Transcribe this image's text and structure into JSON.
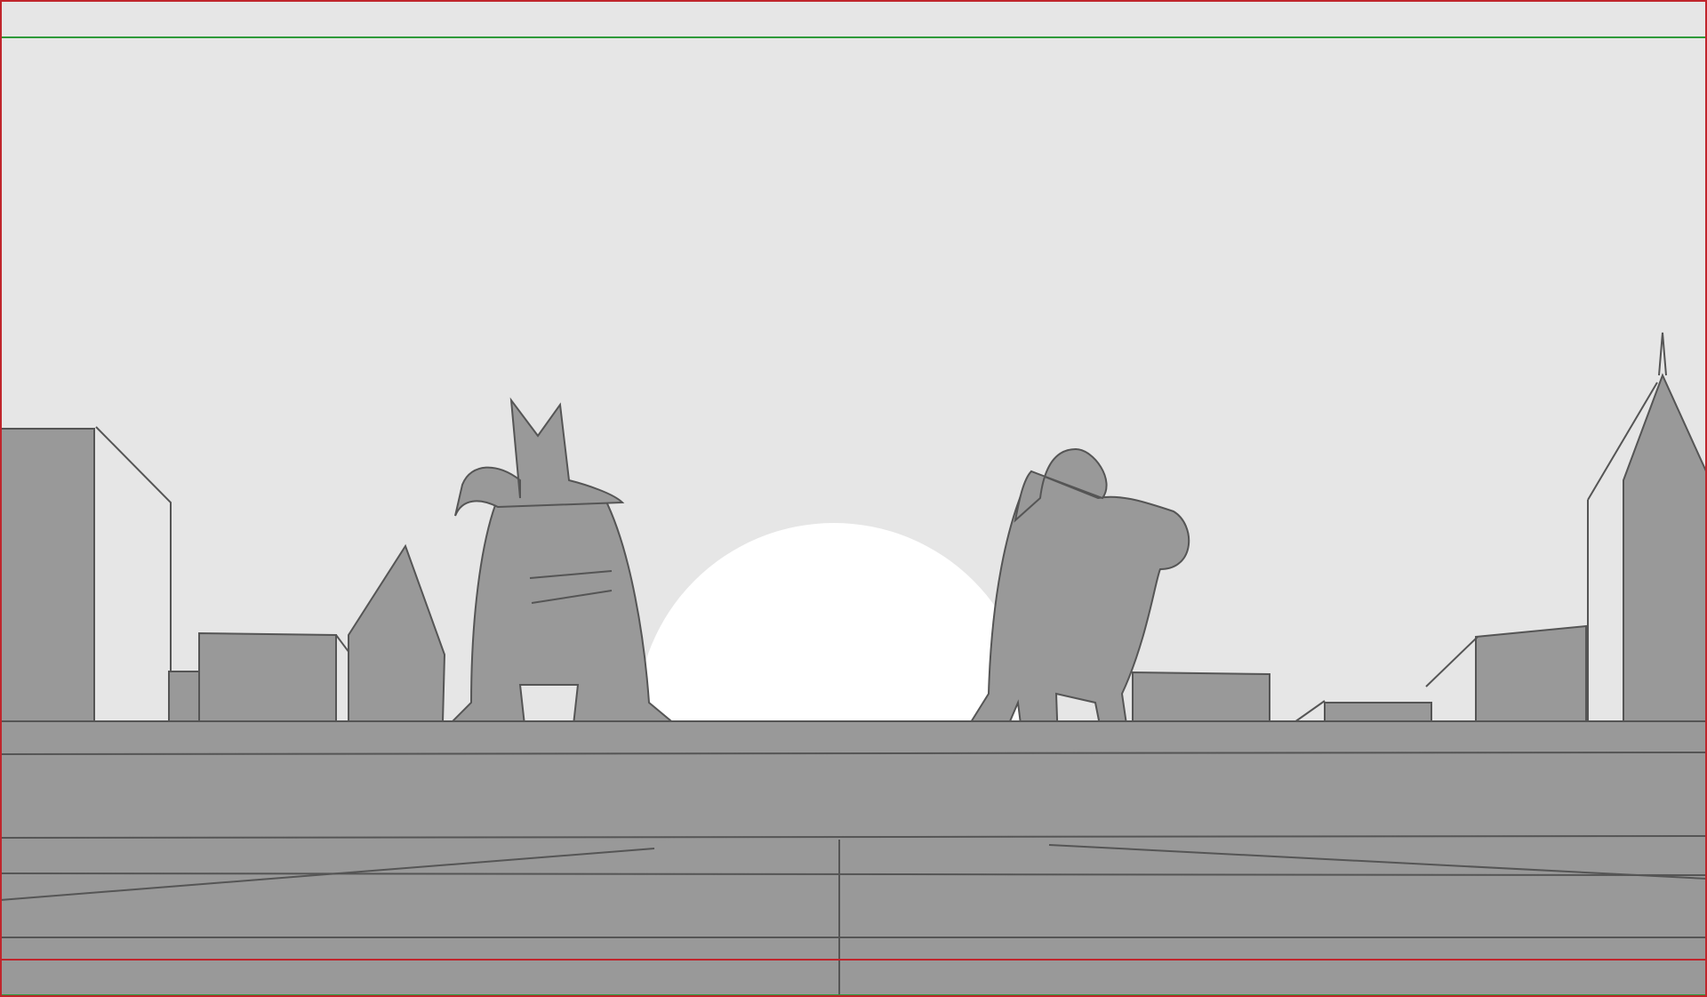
{
  "scene": {
    "description_label": "",
    "colors": {
      "sky": "#e6e6e6",
      "ground": "#999999",
      "buildings": "#999999",
      "sun": "#ffffff",
      "line": "#555555",
      "safe_frame": "#c0252c",
      "title_safe": "#2e9a3a"
    },
    "icons": {
      "frame_border": "frame-border-icon"
    }
  }
}
